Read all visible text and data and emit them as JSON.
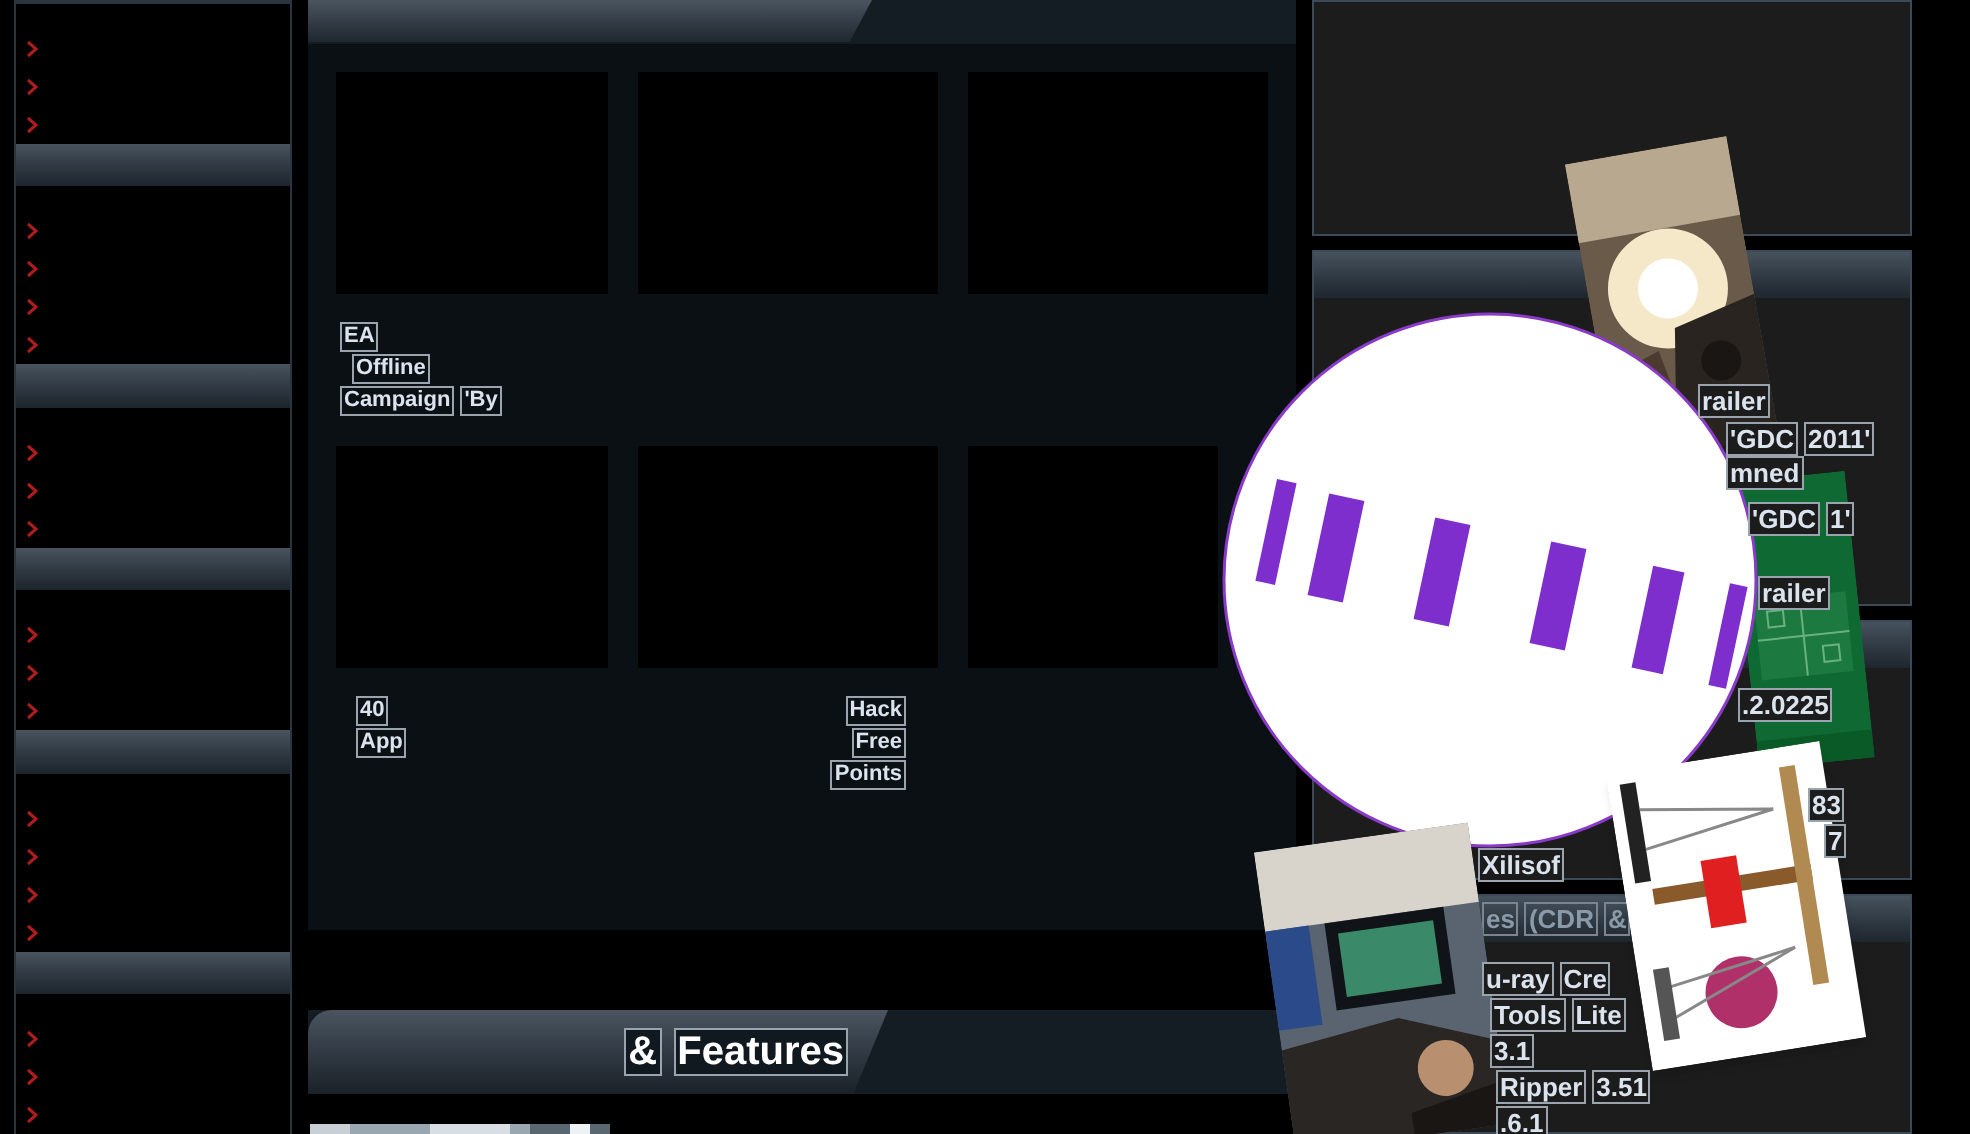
{
  "sidebar": {
    "sections": [
      {
        "header": false,
        "links": [
          {
            "kind": "chevron"
          },
          {
            "kind": "chevron"
          },
          {
            "kind": "chevron"
          }
        ]
      },
      {
        "header": true,
        "links": [
          {
            "kind": "chevron"
          },
          {
            "kind": "chevron"
          },
          {
            "kind": "chevron"
          },
          {
            "kind": "chevron"
          }
        ]
      },
      {
        "header": true,
        "links": [
          {
            "kind": "chevron"
          },
          {
            "kind": "chevron"
          },
          {
            "kind": "chevron"
          }
        ]
      },
      {
        "header": true,
        "links": [
          {
            "kind": "chevron"
          },
          {
            "kind": "chevron"
          },
          {
            "kind": "chevron"
          }
        ]
      },
      {
        "header": true,
        "links": [
          {
            "kind": "chevron"
          },
          {
            "kind": "chevron"
          },
          {
            "kind": "chevron"
          },
          {
            "kind": "chevron"
          }
        ]
      },
      {
        "header": true,
        "links": [
          {
            "kind": "chevron"
          },
          {
            "kind": "chevron"
          },
          {
            "kind": "chevron"
          }
        ]
      }
    ]
  },
  "main_panel": {
    "tiles": [
      {
        "kind": "thumbnail",
        "caption": [
          [
            "EA"
          ],
          [
            "Offline"
          ],
          [
            "Campaign",
            "'By"
          ]
        ]
      },
      {
        "kind": "thumbnail"
      },
      {
        "kind": "thumbnail"
      },
      {
        "kind": "thumbnail",
        "caption": [
          [
            "40"
          ],
          [
            "App"
          ]
        ]
      },
      {
        "kind": "thumbnail",
        "caption": [
          [
            "Hack"
          ],
          [
            "Free"
          ],
          [
            "Points"
          ]
        ]
      },
      {
        "kind": "thumbnail"
      }
    ]
  },
  "features_section": {
    "title_words": [
      "&",
      "Features"
    ],
    "tiles": [
      {
        "kind": "picture"
      },
      {
        "kind": "blank"
      },
      {
        "kind": "blank"
      }
    ]
  },
  "right_panels": [
    {
      "header": false
    },
    {
      "header": true,
      "lines": [
        [
          "railer"
        ],
        [
          "'GDC",
          "2011'"
        ],
        [
          "mned"
        ],
        [
          "'GDC",
          "1'"
        ],
        [
          "railer"
        ]
      ]
    },
    {
      "header": true,
      "lines": [
        [
          ".2.0225"
        ],
        [
          "83"
        ],
        [
          "7"
        ],
        [
          "Xilisof"
        ]
      ]
    },
    {
      "header": true,
      "header_words": [
        "es",
        "(CDR",
        "&"
      ],
      "lines": [
        [
          "u-ray",
          "Cre"
        ],
        [
          "Tools",
          "Lite"
        ],
        [
          "3.1"
        ],
        [
          "Ripper",
          "3.51"
        ],
        [
          ".6.1"
        ]
      ]
    }
  ],
  "overlays": [
    {
      "kind": "picture"
    },
    {
      "kind": "picture"
    },
    {
      "kind": "disc"
    },
    {
      "kind": "picture"
    },
    {
      "kind": "picture"
    }
  ]
}
